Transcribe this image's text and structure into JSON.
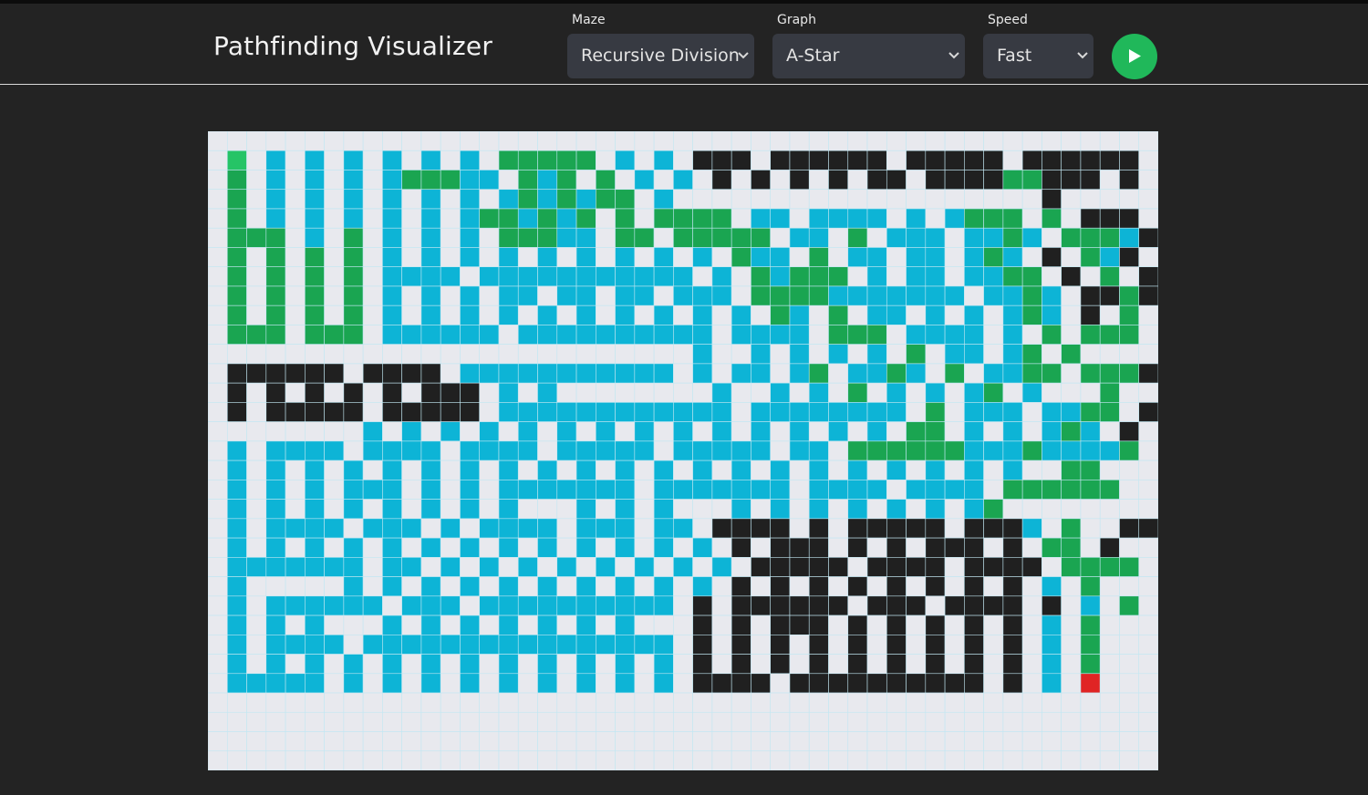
{
  "app": {
    "title": "Pathfinding Visualizer"
  },
  "controls": {
    "maze": {
      "label": "Maze",
      "value": "Recursive Division"
    },
    "graph": {
      "label": "Graph",
      "value": "A-Star"
    },
    "speed": {
      "label": "Speed",
      "value": "Fast"
    },
    "run_icon": "play-icon"
  },
  "colors": {
    "background": "#232323",
    "grid_empty": "#e8e9ee",
    "grid_line": "#c2e7f2",
    "wall": "#202020",
    "visited": "#0db4d6",
    "path": "#1aa551",
    "start": "#25c466",
    "end": "#e02424",
    "run_button": "#20b85a"
  },
  "grid": {
    "cols": 49,
    "rows": 33,
    "legend": {
      ".": "empty",
      "#": "wall",
      "v": "visited",
      "p": "path",
      "S": "start",
      "E": "end"
    },
    "cells": [
      ".................................................",
      ".S.v.v.v.v.v.v.ppppp.v.v.###.######.#####.######.",
      ".p.v.v.v.vpppvv.pvp.p.v.v.#.#.#.#.##.####pp###.#.",
      ".p.v.v.v.v.v.v.vpvpvpp.v...................#.....",
      ".p.v.v.v.v.v.vppvpvp.p.pppp.vv.vvvv.v.vppp.p.###.",
      ".ppp.v.p.v.v.v.pppvv.pp.ppppp.vv.p.vvv.vvpv.pppv#.",
      ".p.p.p.p.v.v.v.v.v.v.v.v.v.pvv.p.vv.vv.vpv.#.pv#.",
      ".p.p.p.p.vvvv.vvvvvvvvvvv.v.pvppp.v.vv.vvpp.#.p.#.",
      ".p.p.p.p.v.v.v.vv.vv.vv.vvv.ppppvvvvvvv.vvpv.##p#.",
      ".p.p.p.p.v.v.v.v.v.v.v.v.v.v.pv.p.vv.v.v.vpv.#.p.#.",
      ".ppp.ppp.vvvvvv.vvvvvvvvvv.vvvv.ppp.vvvv.v.p.ppp.#.",
      ".........................v..v.v.v.v.p.vv.vp.p.....",
      ".######.####.vvvvvvvvvvv.v.vv.vp.vvpv.p.vvpp.ppp##.",
      ".#.#.#.#.#.###.v.v........v..v.v.p.v.v.vp.v...p..",
      ".#.#####.#####.vvvvvvvvvvvv.vvvvvvvv.p.vvv.vvpp.#.",
      "........v.v.v.v.v.v.v.v.v.v.v.v.v.v.pp.v.v.vpv.#.",
      ".v.vvvv.vvvv.vvvv.vvvvv.vvvvv.vv.ppppppvvvpvvvvp.",
      ".v.v.v.v.v.v.v.v.v.v.v.v.v.v.v.v.v.v.v.v.v..pp.",
      ".v.v.v.vvv.v.v.vvvvvvv.vvvvvvv.vvvv.vvvv.pppppp.",
      ".v.v.v.v.v.v.v.v...v.v.v...v.v.v.v.v.v.vp......",
      ".v.vvvv.vvv.v.vvvv.vvv.vv.####.#.#####.###v.p..##.",
      ".v.v.v.v.v.v.v.v.v.v.v.v.v.#.###.#.#.###.#.pp.#.",
      ".vvvvvvv.vv.v.v.v.v.v.v.v.v.#####.####.####.pppp.",
      ".v.....v.v.v.v.v.v.v.v.v.v.#.#.#.#.#.#.#.#.v.p.",
      ".v.vvvvvv.vvv.vvvvvvvvvv.#.######.###.####.#.v.p.",
      ".v.v.v...v.v.v.v.v.v.v...#.#.###.#.#.#.#.#.v.p.",
      ".v.vvvv.vvvvvvvvvvvvvvvv.#.#.#.#.#.#.#.#.#.v.p.",
      ".v.v.v.v.v.v.v.v.v.v.v.v.#.#.#.#.#.#.#.#.#.v.p.",
      ".vvvvv.v.v.v.v.v.v.v.v.v.####.##########.#.v.E.",
      ".................................................",
      ".................................................",
      ".................................................",
      "................................................."
    ]
  }
}
